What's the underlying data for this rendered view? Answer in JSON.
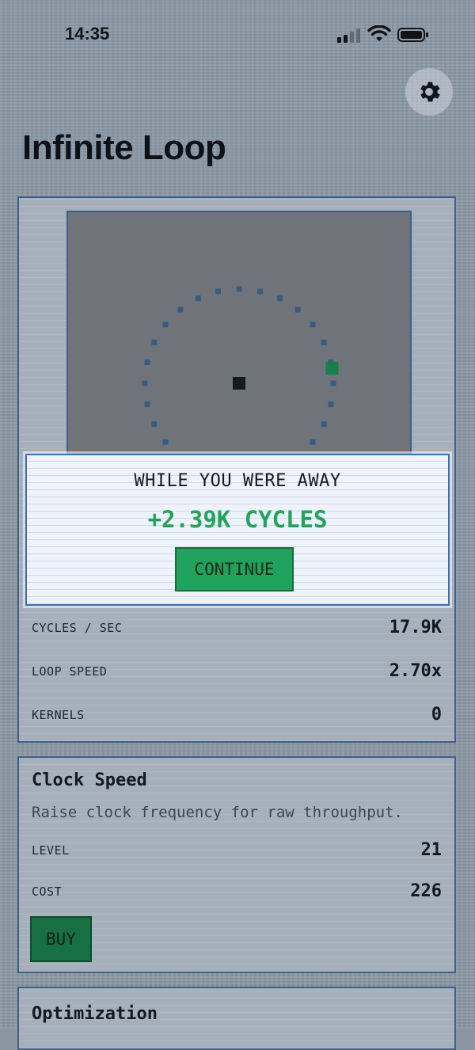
{
  "status_bar": {
    "time": "14:35"
  },
  "header": {
    "title": "Infinite Loop",
    "settings_icon": "gear-icon"
  },
  "modal": {
    "title": "WHILE YOU WERE AWAY",
    "amount": "+2.39K CYCLES",
    "continue_label": "CONTINUE"
  },
  "stats": [
    {
      "label": "CYCLES / SEC",
      "value": "17.9K"
    },
    {
      "label": "LOOP SPEED",
      "value": "2.70x"
    },
    {
      "label": "KERNELS",
      "value": "0"
    }
  ],
  "upgrades": [
    {
      "title": "Clock Speed",
      "description": "Raise clock frequency for raw throughput.",
      "level_label": "LEVEL",
      "level": "21",
      "cost_label": "COST",
      "cost": "226",
      "buy_label": "BUY"
    },
    {
      "title": "Optimization"
    }
  ],
  "colors": {
    "accent_green": "#1fa55a",
    "panel_border": "#3e5f86",
    "loop_dot": "#3c5a7c",
    "runner": "#14804a"
  }
}
